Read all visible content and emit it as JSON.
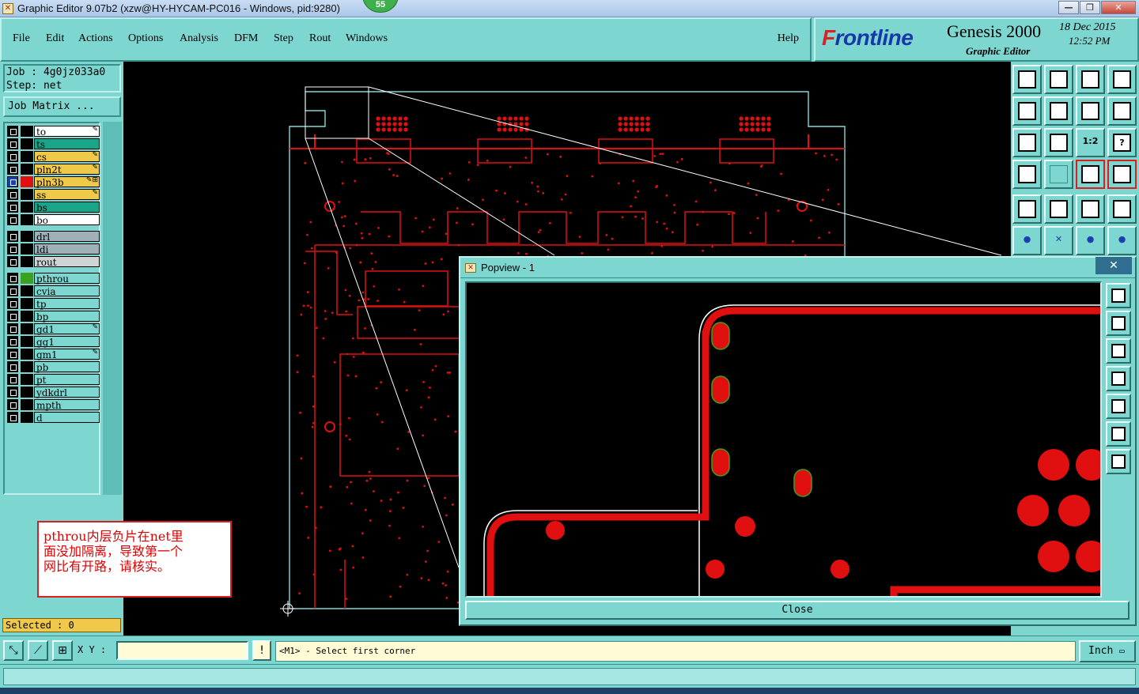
{
  "window": {
    "title": "Graphic Editor 9.07b2 (xzw@HY-HYCAM-PC016 - Windows, pid:9280)",
    "badge": "55",
    "controls": {
      "minimize": "—",
      "restore": "❐",
      "close": "✕"
    }
  },
  "menu": {
    "items": [
      "File",
      "Edit",
      "Actions",
      "Options",
      "Analysis",
      "DFM",
      "Step",
      "Rout",
      "Windows"
    ],
    "help": "Help"
  },
  "logo": {
    "brand_prefix": "F",
    "brand_rest": "rontline",
    "product": "Genesis 2000",
    "subtitle": "Graphic Editor",
    "date": "18 Dec 2015",
    "time": "12:52 PM"
  },
  "job": {
    "job_line": "Job : 4g0jz033a0",
    "step_line": "Step: net",
    "matrix_button": "Job Matrix ..."
  },
  "layers": [
    {
      "name": "to",
      "bg": "#ffffff",
      "swatch": "#000000",
      "edit": "✎"
    },
    {
      "name": "ts",
      "bg": "#1aa58a",
      "swatch": "#000000",
      "edit": ""
    },
    {
      "name": "cs",
      "bg": "#f0c84a",
      "swatch": "#000000",
      "edit": "✎"
    },
    {
      "name": "pln2t",
      "bg": "#f0c84a",
      "swatch": "#000000",
      "edit": "✎"
    },
    {
      "name": "pln3b",
      "bg": "#f0c84a",
      "swatch": "#e01010",
      "edit": "✎⊞",
      "active": true
    },
    {
      "name": "ss",
      "bg": "#f0c84a",
      "swatch": "#000000",
      "edit": "✎"
    },
    {
      "name": "bs",
      "bg": "#1aa58a",
      "swatch": "#000000",
      "edit": ""
    },
    {
      "name": "bo",
      "bg": "#ffffff",
      "swatch": "#000000",
      "edit": ""
    },
    {
      "name": "drl",
      "bg": "#9fb0b8",
      "swatch": "#000000",
      "edit": ""
    },
    {
      "name": "ldi",
      "bg": "#9fb0b8",
      "swatch": "#000000",
      "edit": ""
    },
    {
      "name": "rout",
      "bg": "#d0d4d4",
      "swatch": "#000000",
      "edit": ""
    },
    {
      "name": "pthrou",
      "bg": "#7ed6d0",
      "swatch": "#3aa020",
      "edit": ""
    },
    {
      "name": "cvia",
      "bg": "#7ed6d0",
      "swatch": "#000000",
      "edit": ""
    },
    {
      "name": "tp",
      "bg": "#7ed6d0",
      "swatch": "#000000",
      "edit": ""
    },
    {
      "name": "bp",
      "bg": "#7ed6d0",
      "swatch": "#000000",
      "edit": ""
    },
    {
      "name": "gd1",
      "bg": "#7ed6d0",
      "swatch": "#000000",
      "edit": "✎"
    },
    {
      "name": "gg1",
      "bg": "#7ed6d0",
      "swatch": "#000000",
      "edit": ""
    },
    {
      "name": "gm1",
      "bg": "#7ed6d0",
      "swatch": "#000000",
      "edit": "✎"
    },
    {
      "name": "pb",
      "bg": "#7ed6d0",
      "swatch": "#000000",
      "edit": ""
    },
    {
      "name": "pt",
      "bg": "#7ed6d0",
      "swatch": "#000000",
      "edit": ""
    },
    {
      "name": "ydkdrl",
      "bg": "#7ed6d0",
      "swatch": "#000000",
      "edit": ""
    },
    {
      "name": "mpth",
      "bg": "#7ed6d0",
      "swatch": "#000000",
      "edit": ""
    },
    {
      "name": "d",
      "bg": "#7ed6d0",
      "swatch": "#000000",
      "edit": ""
    }
  ],
  "selected_text": "Selected : 0",
  "note": {
    "line1": "pthrou内层负片在net里",
    "line2": "面没加隔离，导致第一个",
    "line3": "网比有开路，请核实。"
  },
  "popview": {
    "title": "Popview - 1",
    "close_x": "✕",
    "close_button": "Close"
  },
  "tools": {
    "right_icons": [
      "zoom-home-icon",
      "zoom-in-icon",
      "home-icon",
      "panel-icon",
      "pan-left-icon",
      "pan-right-icon",
      "step-icon",
      "snap-icon",
      "fit-icon",
      "center-icon",
      "scale-1-2-icon",
      "help-icon",
      "measure-icon",
      "grid-icon",
      "layer-a-icon",
      "layer-b-icon",
      "select-icon",
      "draw-icon",
      "ruler-icon",
      "pad-icon",
      "net-icon",
      "cross-icon",
      "line-a-icon",
      "line-b-icon"
    ],
    "scale_label": "1:2",
    "help_label": "?"
  },
  "status": {
    "xy_label": "X Y :",
    "xy_value": "",
    "warn": "!",
    "prompt": "<M1> - Select first corner",
    "unit": "Inch"
  },
  "colors": {
    "panel": "#7ed6d0",
    "copper": "#e01010",
    "outline": "#ffffff",
    "accent_green": "#3aa020"
  }
}
